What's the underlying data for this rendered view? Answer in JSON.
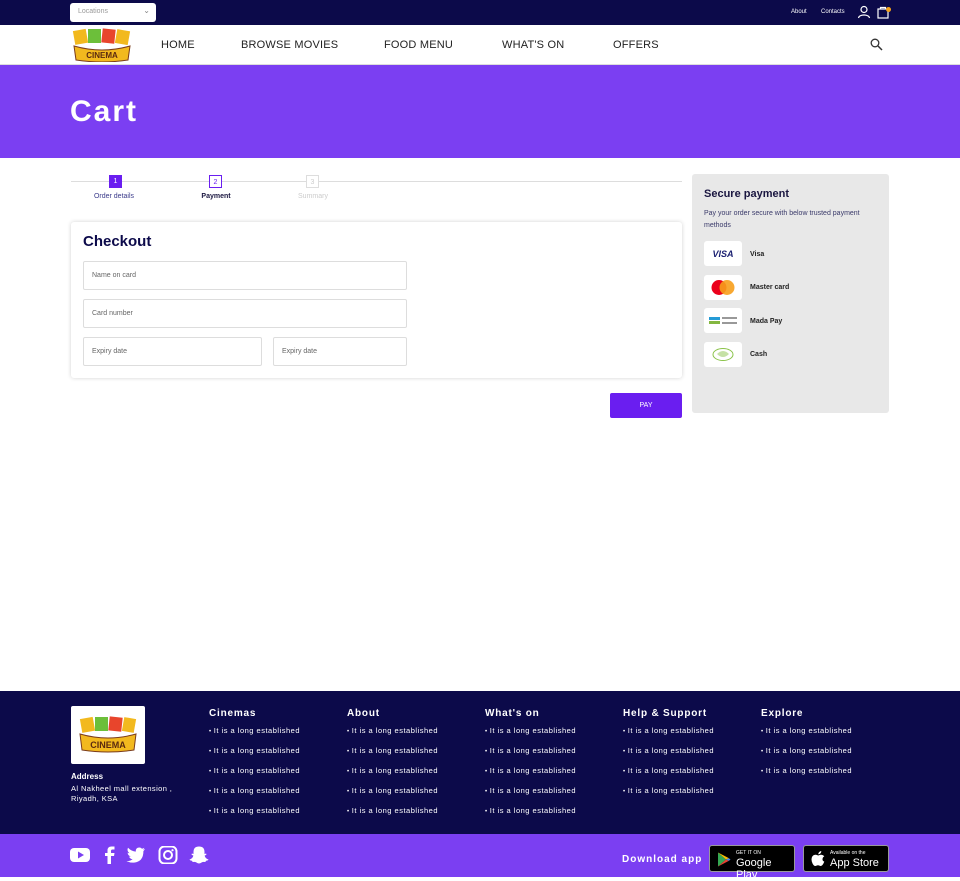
{
  "topbar": {
    "location_placeholder": "Locations",
    "links": [
      "About",
      "Contacts"
    ]
  },
  "logo_text": "CINEMA",
  "nav": [
    "HOME",
    "BROWSE MOVIES",
    "FOOD MENU",
    "WHAT'S ON",
    "OFFERS"
  ],
  "hero": {
    "title": "Cart"
  },
  "steps": [
    {
      "num": "1",
      "label": "Order details"
    },
    {
      "num": "2",
      "label": "Payment"
    },
    {
      "num": "3",
      "label": "Summary"
    }
  ],
  "checkout": {
    "title": "Checkout",
    "fields": {
      "name": "Name on card",
      "card": "Card number",
      "expiry1": "Expiry date",
      "expiry2": "Expiry date"
    },
    "pay_label": "PAY"
  },
  "secure": {
    "title": "Secure payment",
    "desc": "Pay your order secure with below trusted payment methods",
    "methods": [
      {
        "label": "Visa",
        "icon": "visa-icon"
      },
      {
        "label": "Master card",
        "icon": "mastercard-icon"
      },
      {
        "label": "Mada Pay",
        "icon": "mada-icon"
      },
      {
        "label": "Cash",
        "icon": "cash-icon"
      }
    ]
  },
  "footer": {
    "address_title": "Address",
    "address": "Al Nakheel mall extension , Riyadh, KSA",
    "columns": [
      {
        "title": "Cinemas",
        "links": [
          "It is a long established",
          "It is a long established",
          "It is a long established",
          "It is a long established",
          "It is a long established"
        ]
      },
      {
        "title": "About",
        "links": [
          "It is a long established",
          "It is a long established",
          "It is a long established",
          "It is a long established",
          "It is a long established"
        ]
      },
      {
        "title": "What's on",
        "links": [
          "It is a long established",
          "It is a long established",
          "It is a long established",
          "It is a long established",
          "It is a long established"
        ]
      },
      {
        "title": "Help & Support",
        "links": [
          "It is a long established",
          "It is a long established",
          "It is a long established",
          "It is a long established"
        ]
      },
      {
        "title": "Explore",
        "links": [
          "It is a long established",
          "It is a long established",
          "It is a long established"
        ]
      }
    ],
    "download_label": "Download app",
    "google_play": {
      "line1": "GET IT ON",
      "line2": "Google Play"
    },
    "app_store": {
      "line1": "Available on the",
      "line2": "App Store"
    }
  },
  "colors": {
    "navy": "#0c0a4a",
    "purple": "#7b3ff2",
    "button": "#6a1ef0"
  }
}
